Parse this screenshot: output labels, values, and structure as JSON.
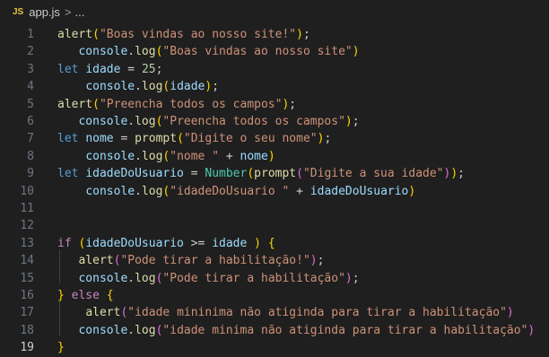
{
  "breadcrumb": {
    "icon_text": "JS",
    "file_name": "app.js",
    "separator": ">",
    "more": "..."
  },
  "editor": {
    "active_line": 19,
    "lines": [
      {
        "n": "1",
        "tokens": [
          {
            "t": "alert",
            "c": "fn"
          },
          {
            "t": "(",
            "c": "b1"
          },
          {
            "t": "\"Boas vindas ao nosso site!\"",
            "c": "str"
          },
          {
            "t": ")",
            "c": "b1"
          },
          {
            "t": ";",
            "c": "pl"
          }
        ]
      },
      {
        "n": "2",
        "tokens": [
          {
            "t": "   ",
            "c": "pl"
          },
          {
            "t": "console",
            "c": "var"
          },
          {
            "t": ".",
            "c": "pl"
          },
          {
            "t": "log",
            "c": "fn"
          },
          {
            "t": "(",
            "c": "b1"
          },
          {
            "t": "\"Boas vindas ao nosso site\"",
            "c": "str"
          },
          {
            "t": ")",
            "c": "b1"
          }
        ]
      },
      {
        "n": "3",
        "tokens": [
          {
            "t": "let",
            "c": "kw"
          },
          {
            "t": " ",
            "c": "pl"
          },
          {
            "t": "idade",
            "c": "var"
          },
          {
            "t": " = ",
            "c": "pl"
          },
          {
            "t": "25",
            "c": "num"
          },
          {
            "t": ";",
            "c": "pl"
          }
        ]
      },
      {
        "n": "4",
        "tokens": [
          {
            "t": "    ",
            "c": "pl"
          },
          {
            "t": "console",
            "c": "var"
          },
          {
            "t": ".",
            "c": "pl"
          },
          {
            "t": "log",
            "c": "fn"
          },
          {
            "t": "(",
            "c": "b1"
          },
          {
            "t": "idade",
            "c": "var"
          },
          {
            "t": ")",
            "c": "b1"
          },
          {
            "t": ";",
            "c": "pl"
          }
        ]
      },
      {
        "n": "5",
        "tokens": [
          {
            "t": "alert",
            "c": "fn"
          },
          {
            "t": "(",
            "c": "b1"
          },
          {
            "t": "\"Preencha todos os campos\"",
            "c": "str"
          },
          {
            "t": ")",
            "c": "b1"
          },
          {
            "t": ";",
            "c": "pl"
          }
        ]
      },
      {
        "n": "6",
        "tokens": [
          {
            "t": "   ",
            "c": "pl"
          },
          {
            "t": "console",
            "c": "var"
          },
          {
            "t": ".",
            "c": "pl"
          },
          {
            "t": "log",
            "c": "fn"
          },
          {
            "t": "(",
            "c": "b1"
          },
          {
            "t": "\"Preencha todos os campos\"",
            "c": "str"
          },
          {
            "t": ")",
            "c": "b1"
          },
          {
            "t": ";",
            "c": "pl"
          }
        ]
      },
      {
        "n": "7",
        "tokens": [
          {
            "t": "let",
            "c": "kw"
          },
          {
            "t": " ",
            "c": "pl"
          },
          {
            "t": "nome",
            "c": "var"
          },
          {
            "t": " = ",
            "c": "pl"
          },
          {
            "t": "prompt",
            "c": "fn"
          },
          {
            "t": "(",
            "c": "b1"
          },
          {
            "t": "\"Digite o seu nome\"",
            "c": "str"
          },
          {
            "t": ")",
            "c": "b1"
          },
          {
            "t": ";",
            "c": "pl"
          }
        ]
      },
      {
        "n": "8",
        "tokens": [
          {
            "t": "    ",
            "c": "pl"
          },
          {
            "t": "console",
            "c": "var"
          },
          {
            "t": ".",
            "c": "pl"
          },
          {
            "t": "log",
            "c": "fn"
          },
          {
            "t": "(",
            "c": "b1"
          },
          {
            "t": "\"nome \"",
            "c": "str"
          },
          {
            "t": " + ",
            "c": "pl"
          },
          {
            "t": "nome",
            "c": "var"
          },
          {
            "t": ")",
            "c": "b1"
          }
        ]
      },
      {
        "n": "9",
        "tokens": [
          {
            "t": "let",
            "c": "kw"
          },
          {
            "t": " ",
            "c": "pl"
          },
          {
            "t": "idadeDoUsuario",
            "c": "var"
          },
          {
            "t": " = ",
            "c": "pl"
          },
          {
            "t": "Number",
            "c": "cls"
          },
          {
            "t": "(",
            "c": "b1"
          },
          {
            "t": "prompt",
            "c": "fn"
          },
          {
            "t": "(",
            "c": "b2"
          },
          {
            "t": "\"Digite a sua idade\"",
            "c": "str"
          },
          {
            "t": ")",
            "c": "b2"
          },
          {
            "t": ")",
            "c": "b1"
          },
          {
            "t": ";",
            "c": "pl"
          }
        ]
      },
      {
        "n": "10",
        "tokens": [
          {
            "t": "    ",
            "c": "pl"
          },
          {
            "t": "console",
            "c": "var"
          },
          {
            "t": ".",
            "c": "pl"
          },
          {
            "t": "log",
            "c": "fn"
          },
          {
            "t": "(",
            "c": "b1"
          },
          {
            "t": "\"idadeDoUsuario \"",
            "c": "str"
          },
          {
            "t": " + ",
            "c": "pl"
          },
          {
            "t": "idadeDoUsuario",
            "c": "var"
          },
          {
            "t": ")",
            "c": "b1"
          }
        ]
      },
      {
        "n": "11",
        "tokens": []
      },
      {
        "n": "12",
        "tokens": []
      },
      {
        "n": "13",
        "tokens": [
          {
            "t": "if",
            "c": "pc"
          },
          {
            "t": " ",
            "c": "pl"
          },
          {
            "t": "(",
            "c": "b1"
          },
          {
            "t": "idadeDoUsuario",
            "c": "var"
          },
          {
            "t": " >= ",
            "c": "pl"
          },
          {
            "t": "idade",
            "c": "var"
          },
          {
            "t": " ",
            "c": "pl"
          },
          {
            "t": ")",
            "c": "b1"
          },
          {
            "t": " ",
            "c": "pl"
          },
          {
            "t": "{",
            "c": "b1"
          }
        ]
      },
      {
        "n": "14",
        "tokens": [
          {
            "t": "   ",
            "c": "pl"
          },
          {
            "t": "alert",
            "c": "fn"
          },
          {
            "t": "(",
            "c": "b2"
          },
          {
            "t": "\"Pode tirar a habilitação!\"",
            "c": "str"
          },
          {
            "t": ")",
            "c": "b2"
          },
          {
            "t": ";",
            "c": "pl"
          }
        ]
      },
      {
        "n": "15",
        "tokens": [
          {
            "t": "   ",
            "c": "pl"
          },
          {
            "t": "console",
            "c": "var"
          },
          {
            "t": ".",
            "c": "pl"
          },
          {
            "t": "log",
            "c": "fn"
          },
          {
            "t": "(",
            "c": "b2"
          },
          {
            "t": "\"Pode tirar a habilitação\"",
            "c": "str"
          },
          {
            "t": ")",
            "c": "b2"
          },
          {
            "t": ";",
            "c": "pl"
          }
        ]
      },
      {
        "n": "16",
        "tokens": [
          {
            "t": "}",
            "c": "b1"
          },
          {
            "t": " ",
            "c": "pl"
          },
          {
            "t": "else",
            "c": "pc"
          },
          {
            "t": " ",
            "c": "pl"
          },
          {
            "t": "{",
            "c": "b1"
          }
        ]
      },
      {
        "n": "17",
        "tokens": [
          {
            "t": "    ",
            "c": "pl"
          },
          {
            "t": "alert",
            "c": "fn"
          },
          {
            "t": "(",
            "c": "b2"
          },
          {
            "t": "\"idade mininima não atiginda para tirar a habilitação\"",
            "c": "str"
          },
          {
            "t": ")",
            "c": "b2"
          }
        ]
      },
      {
        "n": "18",
        "tokens": [
          {
            "t": "   ",
            "c": "pl"
          },
          {
            "t": "console",
            "c": "var"
          },
          {
            "t": ".",
            "c": "pl"
          },
          {
            "t": "log",
            "c": "fn"
          },
          {
            "t": "(",
            "c": "b2"
          },
          {
            "t": "\"idade minima não atiginda para tirar a habilitação\"",
            "c": "str"
          },
          {
            "t": ")",
            "c": "b2"
          }
        ]
      },
      {
        "n": "19",
        "tokens": [
          {
            "t": "}",
            "c": "b1"
          }
        ]
      }
    ]
  }
}
